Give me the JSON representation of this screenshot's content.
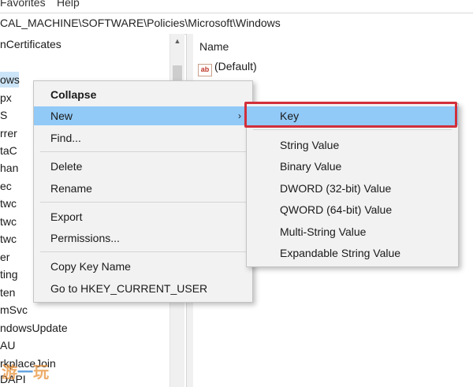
{
  "menubar": {
    "favorites": "Favorites",
    "help": "Help"
  },
  "address": {
    "path": "CAL_MACHINE\\SOFTWARE\\Policies\\Microsoft\\Windows"
  },
  "tree": {
    "items": [
      {
        "label": "nCertificates"
      },
      {
        "label": "ows"
      },
      {
        "label": "px"
      },
      {
        "label": "S"
      },
      {
        "label": "rrer"
      },
      {
        "label": "taC"
      },
      {
        "label": "han"
      },
      {
        "label": "ec"
      },
      {
        "label": "twc"
      },
      {
        "label": "twc"
      },
      {
        "label": "twc"
      },
      {
        "label": "er"
      },
      {
        "label": "ting"
      },
      {
        "label": "ten"
      },
      {
        "label": "mSvc"
      },
      {
        "label": "ndowsUpdate"
      },
      {
        "label": "AU"
      },
      {
        "label": "rkplaceJoin"
      },
      {
        "label": "DAPI"
      }
    ]
  },
  "values": {
    "column_name": "Name",
    "default_icon": "ab",
    "default_name": "(Default)"
  },
  "context_menu": {
    "collapse": "Collapse",
    "new": "New",
    "new_arrow": "›",
    "find": "Find...",
    "delete": "Delete",
    "rename": "Rename",
    "export": "Export",
    "permissions": "Permissions...",
    "copy_key_name": "Copy Key Name",
    "goto": "Go to HKEY_CURRENT_USER"
  },
  "submenu": {
    "key": "Key",
    "string_value": "String Value",
    "binary_value": "Binary Value",
    "dword_value": "DWORD (32-bit) Value",
    "qword_value": "QWORD (64-bit) Value",
    "multi_string_value": "Multi-String Value",
    "expandable_string_value": "Expandable String Value"
  },
  "watermark": {
    "part1": "游",
    "part2": "一",
    "part3": "玩"
  },
  "colors": {
    "highlight_border": "#d22f3a",
    "menu_hover": "#91c9f7",
    "selection": "#cce4f7"
  }
}
